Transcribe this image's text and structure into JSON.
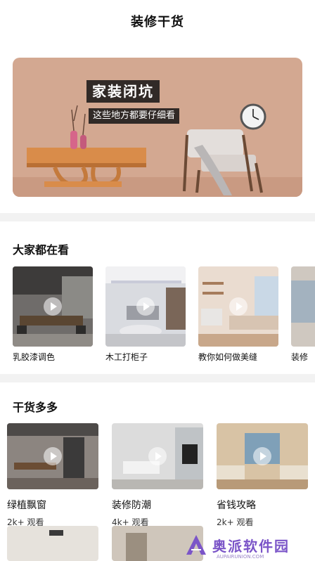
{
  "header": {
    "title": "装修干货"
  },
  "banner": {
    "title": "家装闭坑",
    "subtitle": "这些地方都要仔细看"
  },
  "section_watching": {
    "title": "大家都在看",
    "items": [
      {
        "label": "乳胶漆调色",
        "thumb": "dining-room-photo"
      },
      {
        "label": "木工打柜子",
        "thumb": "living-room-photo"
      },
      {
        "label": "教你如何做美缝",
        "thumb": "bedroom-photo"
      },
      {
        "label": "装修",
        "thumb": "room-photo"
      }
    ]
  },
  "section_tips": {
    "title": "干货多多",
    "items": [
      {
        "label": "绿植飘窗",
        "views": "2k+ 观看"
      },
      {
        "label": "装修防潮",
        "views": "4k+ 观看"
      },
      {
        "label": "省钱攻略",
        "views": "2k+ 观看"
      }
    ]
  },
  "watermark": {
    "name": "奥派软件园",
    "url": "AUPAIRUNION.COM"
  },
  "colors": {
    "banner_bg": "#d3a891",
    "watermark": "#7b55c8"
  }
}
